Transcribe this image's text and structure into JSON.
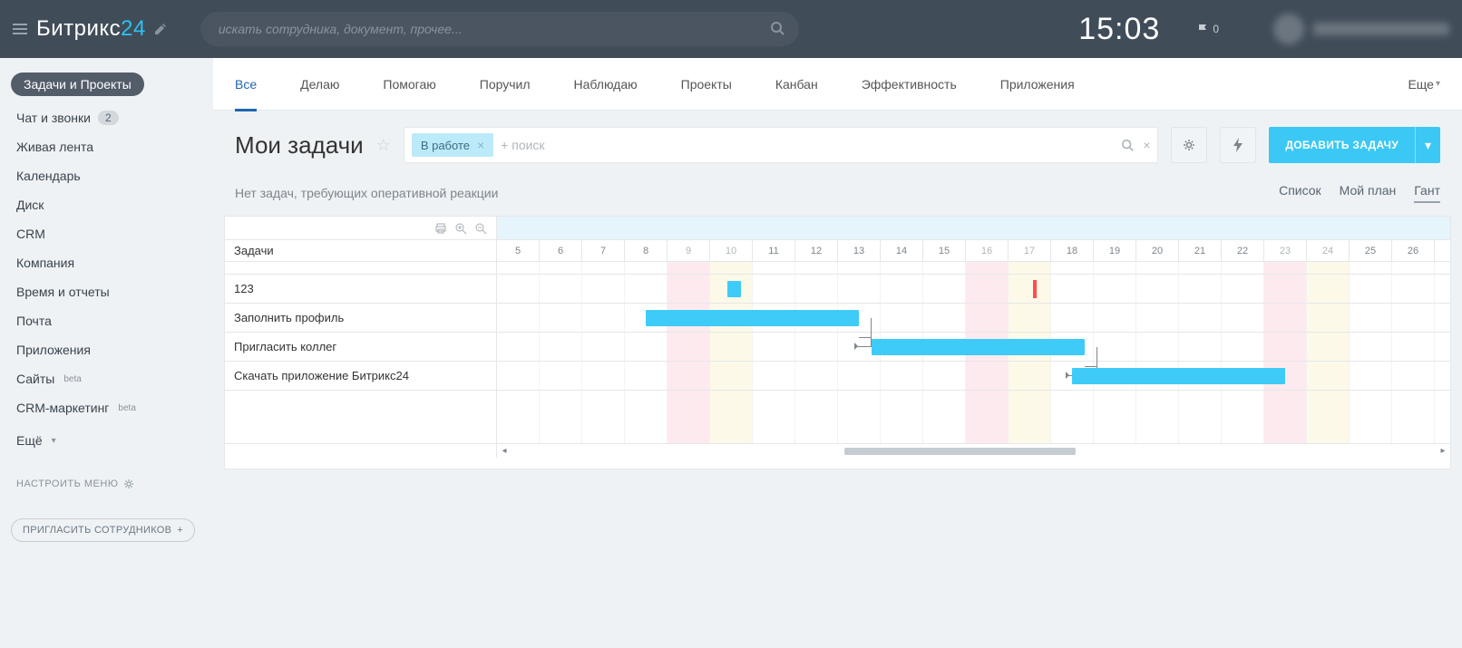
{
  "topbar": {
    "logo_a": "Битрикс",
    "logo_b": "24",
    "search_placeholder": "искать сотрудника, документ, прочее...",
    "clock": "15:03",
    "flag_count": "0"
  },
  "sidebar": {
    "active": "Задачи и Проекты",
    "items": [
      {
        "label": "Чат и звонки",
        "badge": "2"
      },
      {
        "label": "Живая лента"
      },
      {
        "label": "Календарь"
      },
      {
        "label": "Диск"
      },
      {
        "label": "CRM"
      },
      {
        "label": "Компания"
      },
      {
        "label": "Время и отчеты"
      },
      {
        "label": "Почта"
      },
      {
        "label": "Приложения"
      },
      {
        "label": "Сайты",
        "sup": "beta"
      },
      {
        "label": "CRM-маркетинг",
        "sup": "beta"
      }
    ],
    "more": "Ещё",
    "config": "НАСТРОИТЬ МЕНЮ",
    "invite": "ПРИГЛАСИТЬ СОТРУДНИКОВ"
  },
  "tabs": {
    "items": [
      "Все",
      "Делаю",
      "Помогаю",
      "Поручил",
      "Наблюдаю",
      "Проекты",
      "Канбан",
      "Эффективность",
      "Приложения"
    ],
    "more": "Еще"
  },
  "title": {
    "text": "Мои задачи",
    "filter_chip": "В работе",
    "filter_placeholder": "+ поиск",
    "add_button": "ДОБАВИТЬ ЗАДАЧУ"
  },
  "status": {
    "text": "Нет задач, требующих оперативной реакции",
    "views": [
      "Список",
      "Мой план",
      "Гант"
    ]
  },
  "gantt": {
    "left_header": "Задачи",
    "tasks": [
      {
        "name": "123"
      },
      {
        "name": "Заполнить профиль"
      },
      {
        "name": "Пригласить коллег"
      },
      {
        "name": "Скачать приложение Битрикс24"
      }
    ],
    "days": [
      {
        "n": "5"
      },
      {
        "n": "6"
      },
      {
        "n": "7"
      },
      {
        "n": "8"
      },
      {
        "n": "9",
        "sat": true
      },
      {
        "n": "10",
        "sun": true
      },
      {
        "n": "11"
      },
      {
        "n": "12"
      },
      {
        "n": "13"
      },
      {
        "n": "14"
      },
      {
        "n": "15"
      },
      {
        "n": "16",
        "sat": true
      },
      {
        "n": "17",
        "sun": true
      },
      {
        "n": "18"
      },
      {
        "n": "19"
      },
      {
        "n": "20"
      },
      {
        "n": "21"
      },
      {
        "n": "22"
      },
      {
        "n": "23",
        "sat": true
      },
      {
        "n": "24",
        "sun": true
      },
      {
        "n": "25"
      },
      {
        "n": "26"
      }
    ]
  },
  "chart_data": {
    "type": "gantt",
    "x_unit": "day",
    "x_range": [
      5,
      26
    ],
    "tasks": [
      {
        "name": "123",
        "start": 10,
        "end": 10.3,
        "deadline": 17.9
      },
      {
        "name": "Заполнить профиль",
        "start": 8,
        "end": 13
      },
      {
        "name": "Пригласить коллег",
        "start": 13,
        "end": 18
      },
      {
        "name": "Скачать приложение Битрикс24",
        "start": 18,
        "end": 23
      }
    ],
    "dependencies": [
      [
        1,
        2
      ],
      [
        2,
        3
      ]
    ]
  }
}
